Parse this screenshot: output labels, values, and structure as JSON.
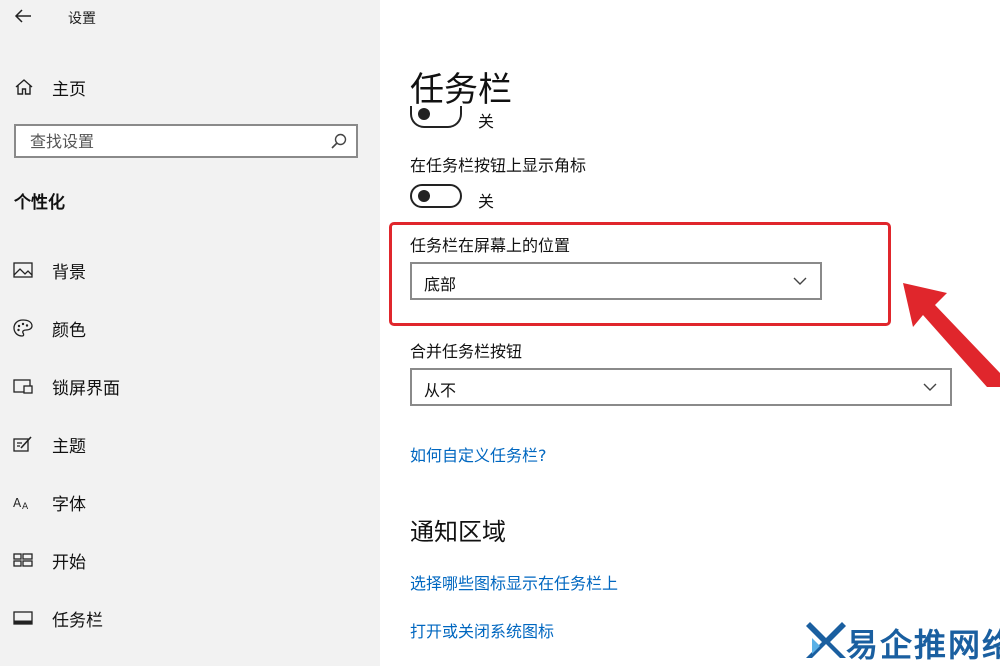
{
  "window": {
    "title": "设置"
  },
  "sidebar": {
    "home_label": "主页",
    "search_placeholder": "查找设置",
    "section_title": "个性化",
    "items": [
      {
        "label": "背景",
        "icon": "image-icon"
      },
      {
        "label": "颜色",
        "icon": "palette-icon"
      },
      {
        "label": "锁屏界面",
        "icon": "lock-screen-icon"
      },
      {
        "label": "主题",
        "icon": "theme-icon"
      },
      {
        "label": "字体",
        "icon": "font-icon"
      },
      {
        "label": "开始",
        "icon": "start-icon"
      },
      {
        "label": "任务栏",
        "icon": "taskbar-icon"
      }
    ]
  },
  "main": {
    "title": "任务栏",
    "partial_toggle_state": "关",
    "badges_setting": {
      "label": "在任务栏按钮上显示角标",
      "state": "关"
    },
    "location_setting": {
      "label": "任务栏在屏幕上的位置",
      "value": "底部"
    },
    "combine_setting": {
      "label": "合并任务栏按钮",
      "value": "从不"
    },
    "customize_link": "如何自定义任务栏?",
    "notification_heading": "通知区域",
    "notification_links": [
      "选择哪些图标显示在任务栏上",
      "打开或关闭系统图标"
    ]
  },
  "annotation": {
    "color": "#e0262c"
  },
  "watermark": {
    "text": "易企推网络",
    "color": "#1a5fa0"
  },
  "colors": {
    "link": "#0067c0",
    "sidebar_bg": "#f2f2f2"
  }
}
